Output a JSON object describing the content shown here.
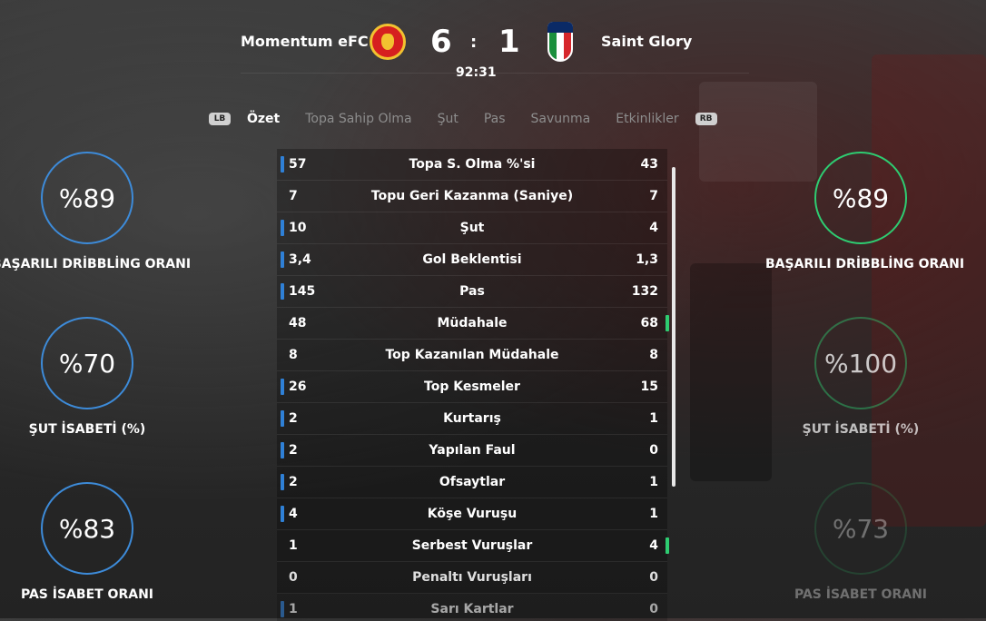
{
  "match": {
    "home_team": "Momentum eFC",
    "away_team": "Saint Glory",
    "home_score": "6",
    "away_score": "1",
    "separator": ":",
    "clock": "92:31"
  },
  "tabs": {
    "left_bumper": "LB",
    "right_bumper": "RB",
    "items": [
      "Özet",
      "Topa Sahip Olma",
      "Şut",
      "Pas",
      "Savunma",
      "Etkinlikler"
    ],
    "active": "Özet"
  },
  "home_rings": [
    {
      "value": "%89",
      "label": "BAŞARILI DRİBBLİNG ORANI"
    },
    {
      "value": "%70",
      "label": "ŞUT İSABETİ (%)"
    },
    {
      "value": "%83",
      "label": "PAS İSABET ORANI"
    }
  ],
  "away_rings": [
    {
      "value": "%89",
      "label": "BAŞARILI DRİBBLİNG ORANI"
    },
    {
      "value": "%100",
      "label": "ŞUT İSABETİ (%)"
    },
    {
      "value": "%73",
      "label": "PAS İSABET ORANI"
    }
  ],
  "stats": [
    {
      "home": "57",
      "name": "Topa S. Olma %'si",
      "away": "43",
      "leader": "home"
    },
    {
      "home": "7",
      "name": "Topu Geri Kazanma (Saniye)",
      "away": "7",
      "leader": "none"
    },
    {
      "home": "10",
      "name": "Şut",
      "away": "4",
      "leader": "home"
    },
    {
      "home": "3,4",
      "name": "Gol Beklentisi",
      "away": "1,3",
      "leader": "home"
    },
    {
      "home": "145",
      "name": "Pas",
      "away": "132",
      "leader": "home"
    },
    {
      "home": "48",
      "name": "Müdahale",
      "away": "68",
      "leader": "away"
    },
    {
      "home": "8",
      "name": "Top Kazanılan Müdahale",
      "away": "8",
      "leader": "none"
    },
    {
      "home": "26",
      "name": "Top Kesmeler",
      "away": "15",
      "leader": "home"
    },
    {
      "home": "2",
      "name": "Kurtarış",
      "away": "1",
      "leader": "home"
    },
    {
      "home": "2",
      "name": "Yapılan Faul",
      "away": "0",
      "leader": "home"
    },
    {
      "home": "2",
      "name": "Ofsaytlar",
      "away": "1",
      "leader": "home"
    },
    {
      "home": "4",
      "name": "Köşe Vuruşu",
      "away": "1",
      "leader": "home"
    },
    {
      "home": "1",
      "name": "Serbest Vuruşlar",
      "away": "4",
      "leader": "away"
    },
    {
      "home": "0",
      "name": "Penaltı Vuruşları",
      "away": "0",
      "leader": "none"
    },
    {
      "home": "1",
      "name": "Sarı Kartlar",
      "away": "0",
      "leader": "home"
    }
  ],
  "colors": {
    "home_accent": "#2f80d6",
    "away_accent": "#2ecc71",
    "home_badge": "#d61f1f"
  }
}
